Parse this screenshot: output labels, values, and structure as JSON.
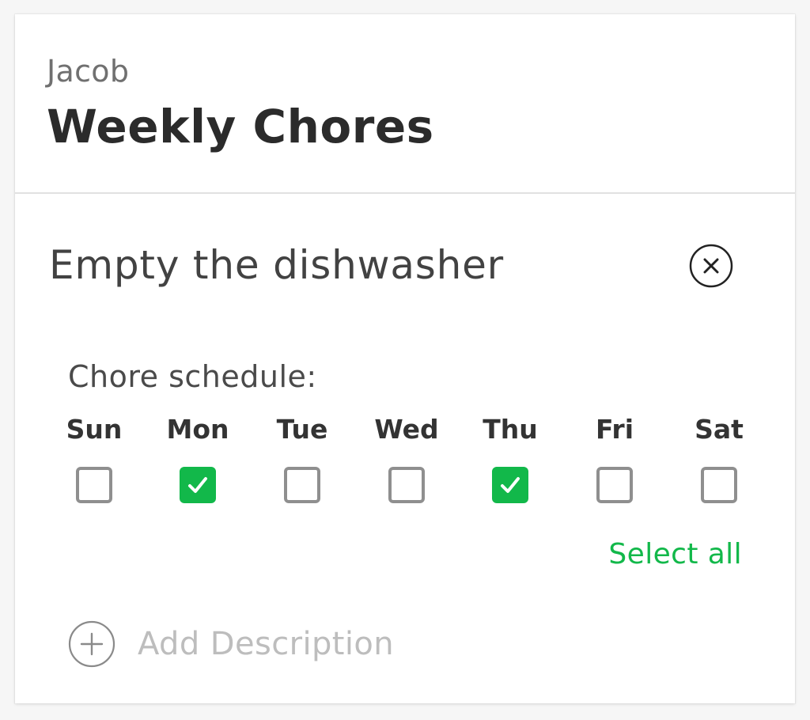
{
  "header": {
    "owner": "Jacob",
    "title": "Weekly Chores"
  },
  "chore": {
    "name": "Empty the dishwasher",
    "remove_icon": "close-circle-icon",
    "schedule_label": "Chore schedule:",
    "days": [
      {
        "label": "Sun",
        "checked": false
      },
      {
        "label": "Mon",
        "checked": true
      },
      {
        "label": "Tue",
        "checked": false
      },
      {
        "label": "Wed",
        "checked": false
      },
      {
        "label": "Thu",
        "checked": true
      },
      {
        "label": "Fri",
        "checked": false
      },
      {
        "label": "Sat",
        "checked": false
      }
    ],
    "select_all_label": "Select all",
    "add_description_label": "Add Description",
    "add_icon": "plus-circle-icon"
  },
  "colors": {
    "accent": "#12b84a",
    "checkbox_border": "#8f8f8f",
    "placeholder": "#bdbdbd"
  }
}
